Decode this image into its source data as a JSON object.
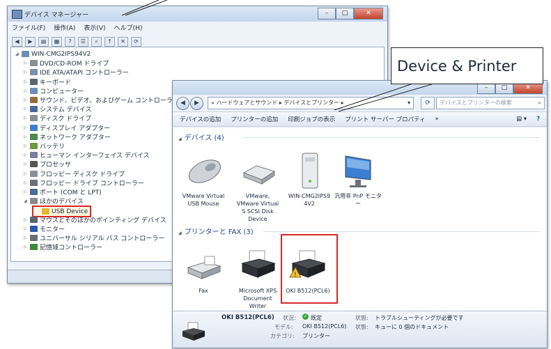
{
  "device_manager": {
    "title": "デバイス マネージャー",
    "menu": [
      "ファイル(F)",
      "操作(A)",
      "表示(V)",
      "ヘルプ(H)"
    ],
    "tree": [
      {
        "label": "WIN-CMG2IPS94V2",
        "level": 0,
        "expanded": true,
        "icon": "computer-icon"
      },
      {
        "label": "DVD/CD-ROM ドライブ",
        "level": 1,
        "icon": "disc-drive-icon"
      },
      {
        "label": "IDE ATA/ATAPI コントローラー",
        "level": 1,
        "icon": "ide-controller-icon"
      },
      {
        "label": "キーボード",
        "level": 1,
        "icon": "keyboard-icon"
      },
      {
        "label": "コンピューター",
        "level": 1,
        "icon": "computer-icon"
      },
      {
        "label": "サウンド、ビデオ、およびゲーム コントローラー",
        "level": 1,
        "icon": "sound-icon"
      },
      {
        "label": "システム デバイス",
        "level": 1,
        "icon": "system-device-icon"
      },
      {
        "label": "ディスク ドライブ",
        "level": 1,
        "icon": "disk-drive-icon"
      },
      {
        "label": "ディスプレイ アダプター",
        "level": 1,
        "icon": "display-adapter-icon"
      },
      {
        "label": "ネットワーク アダプター",
        "level": 1,
        "icon": "network-adapter-icon"
      },
      {
        "label": "バッテリ",
        "level": 1,
        "icon": "battery-icon"
      },
      {
        "label": "ヒューマン インターフェイス デバイス",
        "level": 1,
        "icon": "hid-icon"
      },
      {
        "label": "プロセッサ",
        "level": 1,
        "icon": "processor-icon"
      },
      {
        "label": "フロッピー ディスク ドライブ",
        "level": 1,
        "icon": "floppy-drive-icon"
      },
      {
        "label": "フロッピー ドライブ コントローラー",
        "level": 1,
        "icon": "floppy-controller-icon"
      },
      {
        "label": "ポート (COM と LPT)",
        "level": 1,
        "icon": "port-icon"
      },
      {
        "label": "ほかのデバイス",
        "level": 1,
        "expanded": true,
        "icon": "other-devices-icon"
      },
      {
        "label": "USB Device",
        "level": 2,
        "icon": "warning-device-icon",
        "highlighted": true
      },
      {
        "label": "マウスとそのほかのポインティング デバイス",
        "level": 1,
        "icon": "mouse-icon"
      },
      {
        "label": "モニター",
        "level": 1,
        "icon": "monitor-icon"
      },
      {
        "label": "ユニバーサル シリアル バス コントローラー",
        "level": 1,
        "icon": "usb-controller-icon"
      },
      {
        "label": "記憶域コントローラー",
        "level": 1,
        "icon": "storage-controller-icon"
      }
    ]
  },
  "devices_printers": {
    "address": "« ハードウェアとサウンド ▸ デバイスとプリンター ▸",
    "search_placeholder": "デバイスとプリンターの検索",
    "commands": [
      "デバイスの追加",
      "プリンターの追加",
      "印刷ジョブの表示",
      "プリント サーバー プロパティ",
      "»"
    ],
    "devices_header": "デバイス (4)",
    "devices": [
      "VMware Virtual USB Mouse",
      "VMware, VMware Virtual S SCSI Disk Device",
      "WIN-CMG2IPS9 4V2",
      "汎用非 PnP モニター"
    ],
    "printers_header": "プリンターと FAX (3)",
    "printers": [
      "Fax",
      "Microsoft XPS Document Writer",
      "OKI B512(PCL6)"
    ],
    "details": {
      "name": "OKI B512(PCL6)",
      "status_label": "状況:",
      "status_value": "既定",
      "model_label": "モデル:",
      "model_value": "OKI B512(PCL6)",
      "category_label": "カテゴリ:",
      "category_value": "プリンター",
      "state_label1": "状態:",
      "state_value1": "トラブルシューティングが必要です",
      "state_label2": "状態:",
      "state_value2": "キューに 0 個のドキュメント"
    }
  },
  "callout": {
    "text": "Device & Printer"
  },
  "colors": {
    "highlight_red": "#d8262a",
    "accent_blue": "#1e3d8a",
    "status_green": "#3aa53a"
  }
}
